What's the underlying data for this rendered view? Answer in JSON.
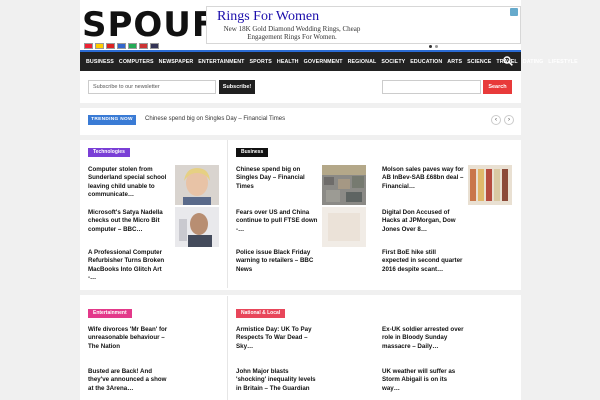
{
  "header": {
    "logo": "SPOUF",
    "flags": [
      {
        "name": "ca",
        "color": "#e23"
      },
      {
        "name": "de",
        "color": "#fc0"
      },
      {
        "name": "es",
        "color": "#d22"
      },
      {
        "name": "fr",
        "color": "#36c"
      },
      {
        "name": "it",
        "color": "#2a5"
      },
      {
        "name": "gb",
        "color": "#c33"
      },
      {
        "name": "us",
        "color": "#335"
      }
    ]
  },
  "ad": {
    "title": "Rings For Women",
    "text": "New 18K Gold Diamond Wedding Rings, Cheap Engagement Rings For Women."
  },
  "nav": {
    "items": [
      "BUSINESS",
      "COMPUTERS",
      "NEWSPAPER",
      "ENTERTAINMENT",
      "SPORTS",
      "HEALTH",
      "GOVERNMENT",
      "REGIONAL",
      "SOCIETY",
      "EDUCATION",
      "ARTS",
      "SCIENCE",
      "TRAVEL",
      "DATING",
      "LIFESTYLE"
    ]
  },
  "newsletter": {
    "placeholder": "Subscribe to our newsletter",
    "button": "Subscribe!"
  },
  "search": {
    "button": "Search"
  },
  "trending": {
    "badge": "TRENDING NOW",
    "headline": "Chinese spend big on Singles Day – Financial Times",
    "prev": "‹",
    "next": "›"
  },
  "sections": {
    "technologies": {
      "label": "Technologies",
      "color": "#7a3fd6",
      "articles": [
        "Computer stolen from Sunderland special school leaving child unable to communicate…",
        "Microsoft's Satya Nadella checks out the Micro Bit computer – BBC…",
        "A Professional Computer Refurbisher Turns Broken MacBooks Into Glitch Art -…"
      ]
    },
    "business": {
      "label": "Business",
      "color": "#111111",
      "articles": [
        "Chinese spend big on Singles Day – Financial Times",
        "Fears over US and China continue to pull FTSE down -…",
        "Police issue Black Friday warning to retailers – BBC News"
      ]
    },
    "business_right": {
      "articles": [
        "Molson sales paves way for AB InBev-SAB £68bn deal – Financial…",
        "Digital Don Accused of Hacks at JPMorgan, Dow Jones Over 8…",
        "First BoE hike still expected in second quarter 2016 despite scant…"
      ]
    },
    "entertainment": {
      "label": "Entertainment",
      "color": "#e3398a",
      "articles": [
        "Wife divorces 'Mr Bean' for unreasonable behaviour – The Nation",
        "Busted are Back! And they've announced a show at the 3Arena…"
      ]
    },
    "national": {
      "label": "National & Local",
      "color": "#e8465a",
      "articles": [
        "Armistice Day: UK To Pay Respects To War Dead – Sky…",
        "John Major blasts 'shocking' inequality levels in Britain – The Guardian"
      ]
    },
    "national_right": {
      "articles": [
        "Ex-UK soldier arrested over role in Bloody Sunday massacre – Daily…",
        "UK weather will suffer as Storm Abigail is on its way…"
      ]
    }
  }
}
